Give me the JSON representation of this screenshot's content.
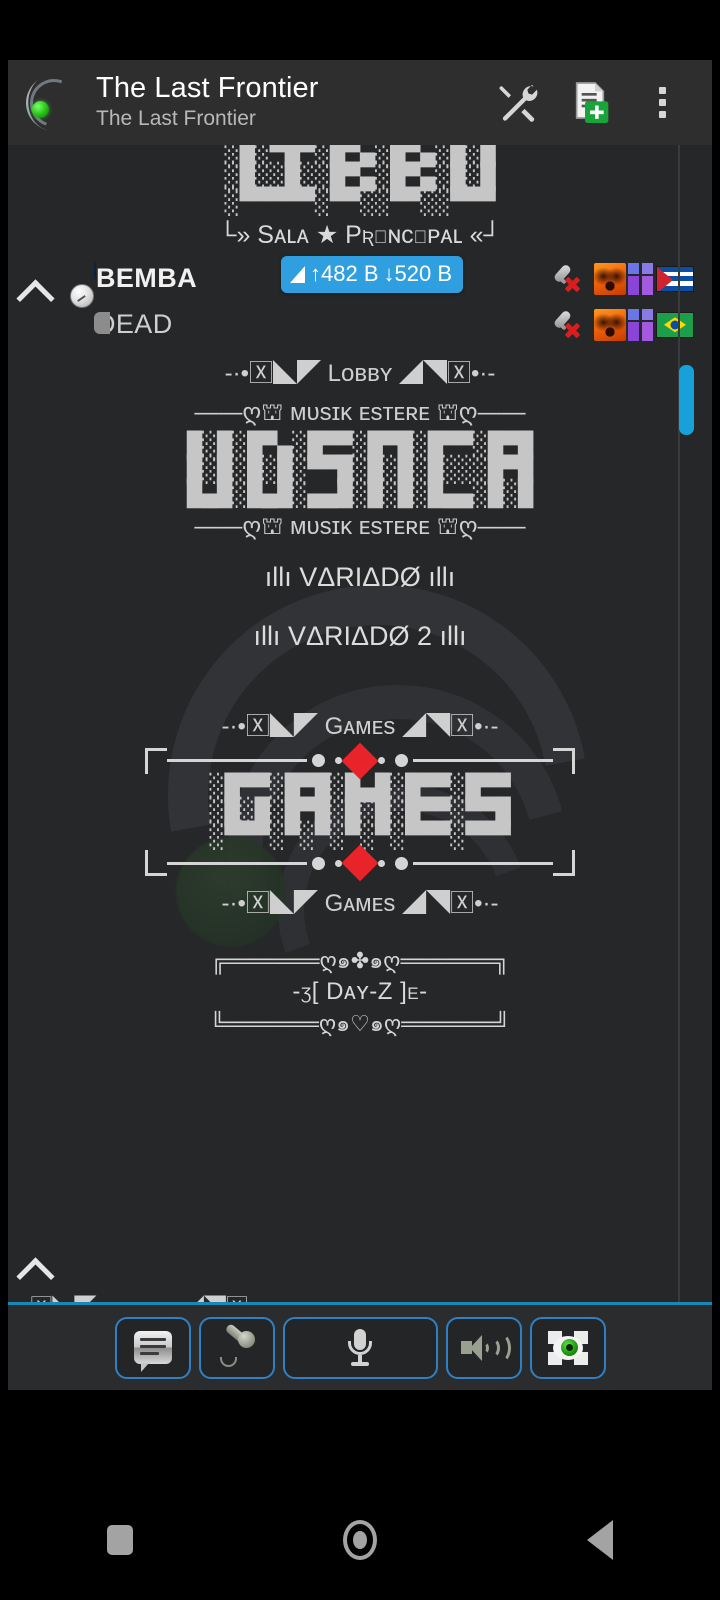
{
  "app": {
    "title": "The Last Frontier",
    "subtitle": "The Last Frontier",
    "logo_icon": "headset-crescent-logo"
  },
  "appbar": {
    "actions": [
      {
        "name": "tools-icon",
        "label": "Tools"
      },
      {
        "name": "new-document-icon",
        "label": "New Document"
      },
      {
        "name": "overflow-menu-icon",
        "label": "More options"
      }
    ]
  },
  "status_badge": {
    "signal_icon": "signal-strength-icon",
    "upload": "↑482 B",
    "download": "↓520 B",
    "color": "#2f9fe0"
  },
  "channels": {
    "banner_top": [
      "░█░▀█▀░█▀▄░█▀▄░█░█",
      "░█░░█░░█▀▄░█▀▄░█░█",
      "░▀▀▀▀▀░▀▀░░▀▀░░▀▀▀"
    ],
    "sala_principal": "└» Sᴀʟᴀ ★ Pʀɪɴᴄɪᴘᴀʟ «┘",
    "lobby_sep": "-·•🅇◣◤ Lᴏʙʙʏ ◢◥🅇•·-",
    "musik_sep_left": "——ღ⛫ ᴍᴜsɪᴋ",
    "musik_sep_right": "ᴇsᴛᴇʀᴇ ⛫ღ——",
    "banner_musica": [
      "█░█░█▀▄░█▀▀░█▀█░█▀▀░█▀█",
      "█░█░█░█░▀▀█░█░█░█░░░█▀█",
      "█▄█░█▄█░▄▄█░█░█░█▄▄░█░█"
    ],
    "variado_1": "ıllı VΔRIΔDØ ıllı",
    "variado_2": "ıllı VΔRIΔDØ 2 ıllı",
    "games_sep": "-·•🅇◣◤ Gᴀᴍᴇs ◢◥🅇•·-",
    "banner_games": [
      "░█▀▀░█▀█░█▄█░█▀▀░█▀▀",
      "░█░█░█▀█░█░█░█▀▀░▀▀█",
      "░▀▀▀░▀░▀░▀░▀░▀▀▀░▀▀▀"
    ],
    "dayz_top_border": "╔══════ღ๑✤๑ღ══════╗",
    "dayz_title": "-ʒ[ Dᴀʏ-Z ]ε-",
    "dayz_bottom_border": "╚══════ღ๑♡๑ღ══════╝",
    "partial_next": "-·•🅇◣◤ ·········· ◢◥🅇•·-"
  },
  "users": [
    {
      "name": "BEMBA",
      "status_icon": "online-blue-orb-icon",
      "badges": [
        "mic-muted-icon",
        "flame-avatar-icon",
        "purple-rank-icon",
        "flag-cuba-icon"
      ]
    },
    {
      "name": "DEAD",
      "status_icon": "away-clock-icon",
      "badges": [
        "mic-muted-icon",
        "flame-avatar-icon",
        "purple-rank-icon",
        "flag-brazil-icon"
      ]
    }
  ],
  "collapse": {
    "icon": "chevron-up-icon"
  },
  "scrollbar": {
    "color": "#18a0d8"
  },
  "toolbar": {
    "buttons": [
      {
        "name": "chat-button",
        "icon": "chat-bubble-icon",
        "label": "Chat"
      },
      {
        "name": "record-button",
        "icon": "microphone-stand-icon",
        "label": "Record"
      },
      {
        "name": "push-to-talk-button",
        "icon": "microphone-icon",
        "label": "Push To Talk"
      },
      {
        "name": "speaker-button",
        "icon": "speaker-waves-icon",
        "label": "Speaker"
      },
      {
        "name": "video-button",
        "icon": "eye-camera-icon",
        "label": "Video"
      }
    ],
    "accent": "#2f81c4"
  },
  "navbar": {
    "items": [
      {
        "name": "recents-button",
        "icon": "square-icon"
      },
      {
        "name": "home-button",
        "icon": "circle-icon"
      },
      {
        "name": "back-button",
        "icon": "triangle-left-icon"
      }
    ]
  }
}
